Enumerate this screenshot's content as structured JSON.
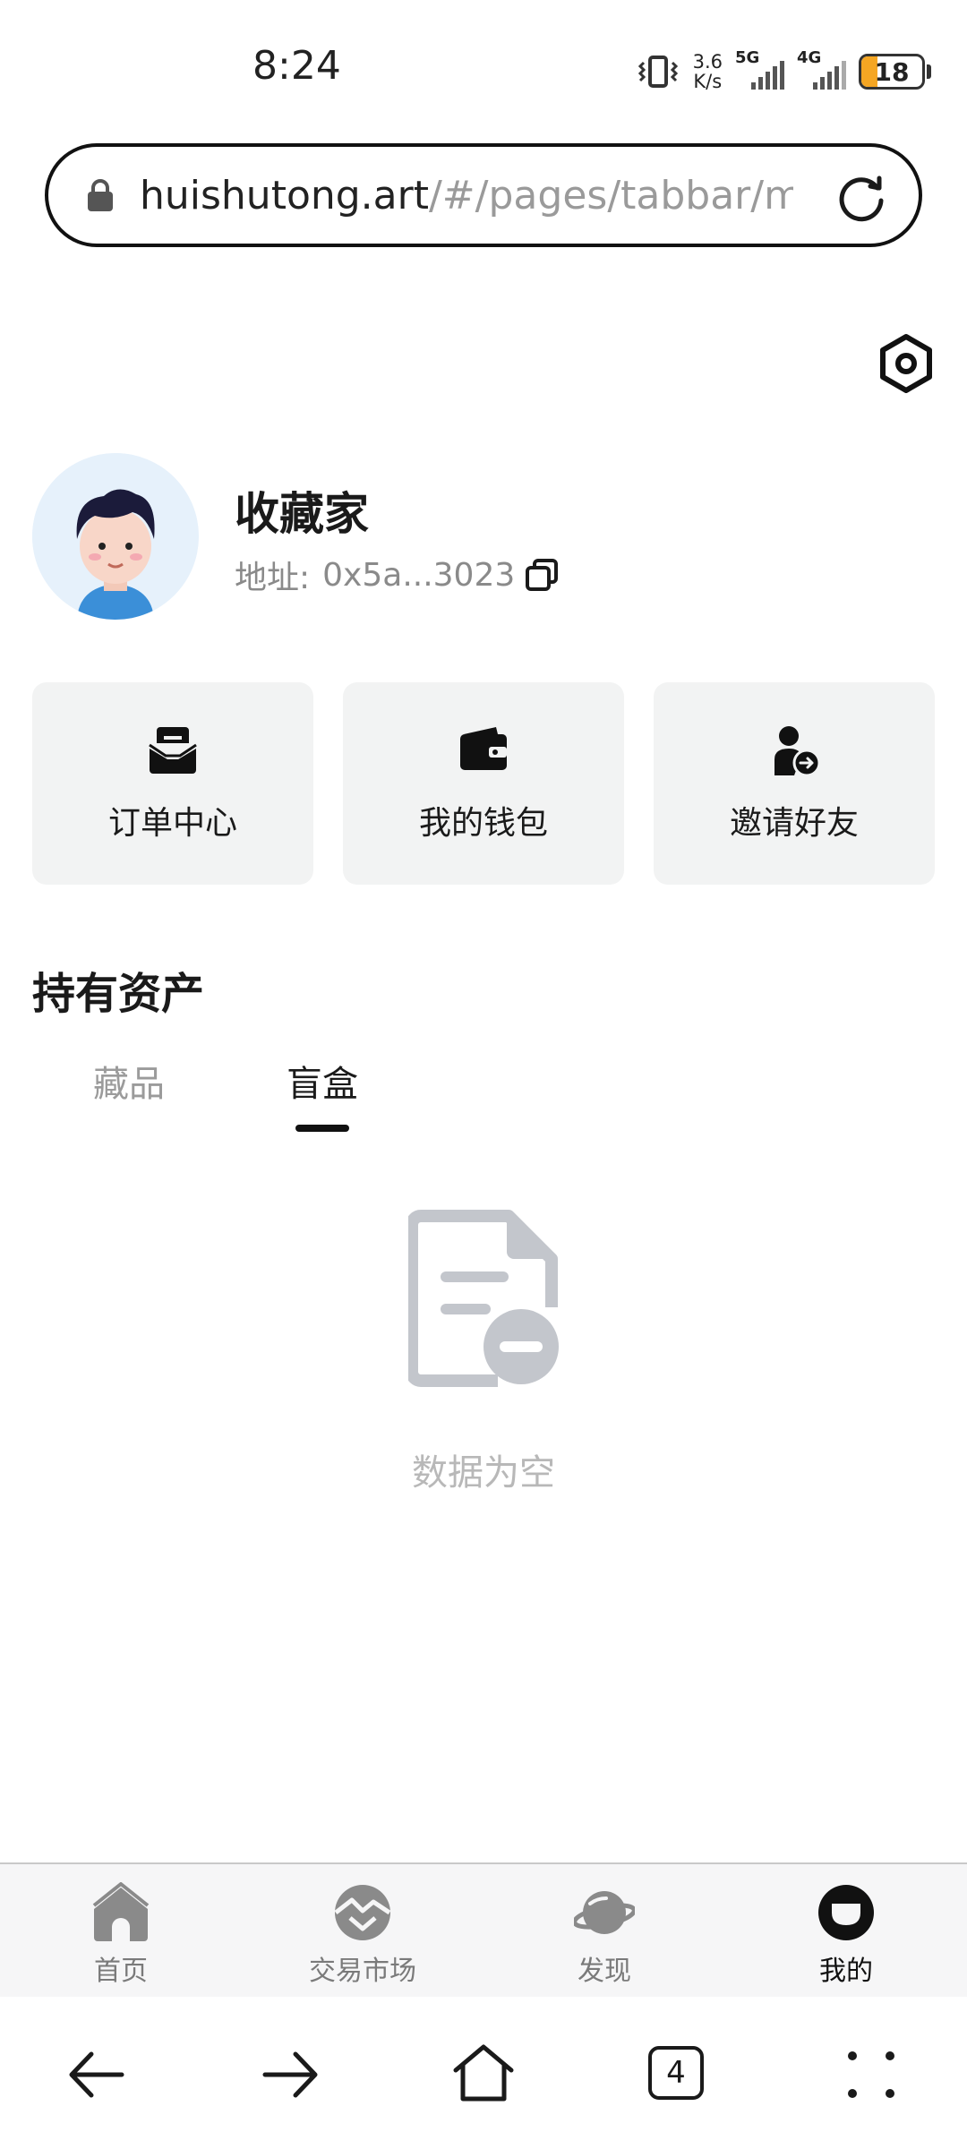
{
  "status_bar": {
    "time": "8:24",
    "speed_value": "3.6",
    "speed_unit": "K/s",
    "net1": "5G",
    "net2": "4G",
    "battery": "18"
  },
  "browser": {
    "url_host": "huishutong.art",
    "url_path": "/#/pages/tabbar/m"
  },
  "profile": {
    "name": "收藏家",
    "address_label": "地址:",
    "address_value": "0x5a...3023"
  },
  "quick_actions": [
    {
      "label": "订单中心",
      "icon": "order-inbox-icon"
    },
    {
      "label": "我的钱包",
      "icon": "wallet-icon"
    },
    {
      "label": "邀请好友",
      "icon": "invite-user-icon"
    }
  ],
  "assets": {
    "title": "持有资产",
    "tabs": [
      {
        "label": "藏品",
        "active": false
      },
      {
        "label": "盲盒",
        "active": true
      }
    ],
    "empty_text": "数据为空"
  },
  "tabbar": [
    {
      "label": "首页",
      "icon": "home-icon",
      "active": false
    },
    {
      "label": "交易市场",
      "icon": "market-icon",
      "active": false
    },
    {
      "label": "发现",
      "icon": "planet-icon",
      "active": false
    },
    {
      "label": "我的",
      "icon": "profile-icon",
      "active": true
    }
  ],
  "browser_nav": {
    "tabs_count": "4"
  },
  "colors": {
    "card_bg": "#f2f3f3",
    "inactive_tab": "#9b9b9b",
    "empty_gray": "#c3c6cc",
    "battery_fill": "#f5a623"
  }
}
